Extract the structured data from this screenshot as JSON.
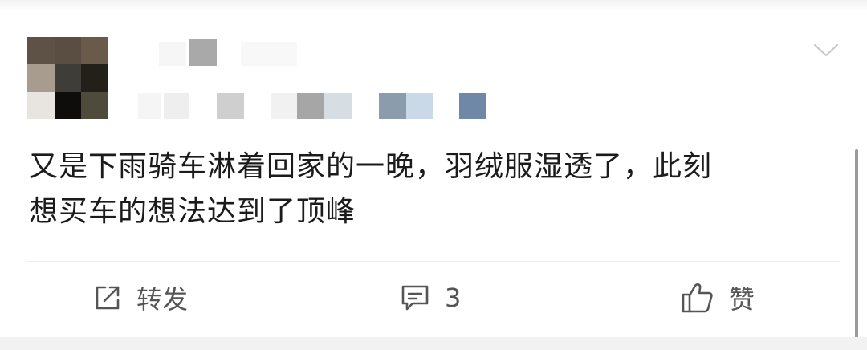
{
  "post": {
    "text_line1": "又是下雨骑车淋着回家的一晚，羽绒服湿透了，此刻",
    "text_line2": "想买车的想法达到了顶峰"
  },
  "actions": {
    "repost_label": "转发",
    "comment_count": "3",
    "like_label": "赞"
  },
  "icons": {
    "repost": "share-out-icon",
    "comment": "comment-bubble-icon",
    "like": "thumbs-up-icon",
    "menu": "chevron-down-icon"
  },
  "colors": {
    "text": "#1b1b1b",
    "action_text": "#555555",
    "divider": "#ececec"
  }
}
